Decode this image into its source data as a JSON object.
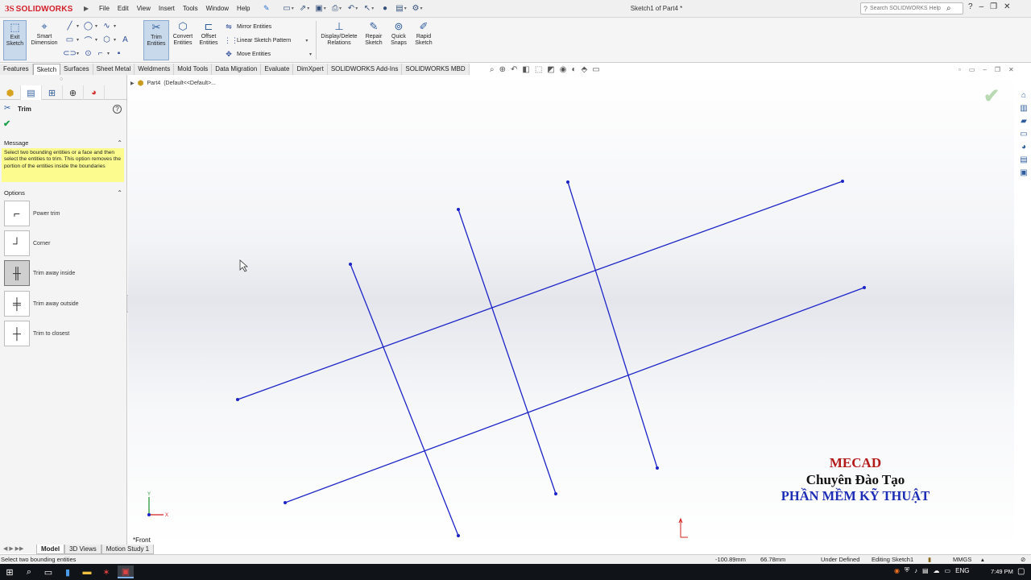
{
  "app": {
    "logo_ds": "3S",
    "logo_name": "SOLIDWORKS",
    "doc_title": "Sketch1 of Part4 *"
  },
  "menu": [
    "File",
    "Edit",
    "View",
    "Insert",
    "Tools",
    "Window",
    "Help"
  ],
  "search": {
    "placeholder": "Search SOLIDWORKS Help"
  },
  "command_manager": {
    "exit_sketch": "Exit\nSketch",
    "smart_dimension": "Smart\nDimension",
    "trim_entities": "Trim\nEntities",
    "convert_entities": "Convert\nEntities",
    "offset_entities": "Offset\nEntities",
    "mirror_entities": "Mirror Entities",
    "linear_sketch_pattern": "Linear Sketch Pattern",
    "move_entities": "Move Entities",
    "display_delete_relations": "Display/Delete\nRelations",
    "repair_sketch": "Repair\nSketch",
    "quick_snaps": "Quick\nSnaps",
    "rapid_sketch": "Rapid\nSketch"
  },
  "tabs": [
    "Features",
    "Sketch",
    "Surfaces",
    "Sheet Metal",
    "Weldments",
    "Mold Tools",
    "Data Migration",
    "Evaluate",
    "DimXpert",
    "SOLIDWORKS Add-Ins",
    "SOLIDWORKS MBD"
  ],
  "active_tab": "Sketch",
  "property_manager": {
    "title": "Trim",
    "message_header": "Message",
    "message": "Select two bounding entities or a face and then select the entities to trim. This option removes the portion of the entities inside the boundaries",
    "options_header": "Options",
    "options": [
      {
        "label": "Power trim",
        "selected": false
      },
      {
        "label": "Corner",
        "selected": false
      },
      {
        "label": "Trim away inside",
        "selected": true
      },
      {
        "label": "Trim away outside",
        "selected": false
      },
      {
        "label": "Trim to closest",
        "selected": false
      }
    ]
  },
  "tree": {
    "part": "Part4",
    "config": "(Default<<Default>..."
  },
  "view_label": "*Front",
  "watermark": {
    "line1": "MECAD",
    "line2": "Chuyên  Đào Tạo",
    "line3": "PHẦN MỀM KỸ THUẬT"
  },
  "bottom_tabs": [
    "Model",
    "3D Views",
    "Motion Study 1"
  ],
  "active_bottom_tab": "Model",
  "status": {
    "hint": "Select two bounding entities",
    "x": "-100.89mm",
    "y": "66.78mm",
    "state": "Under Defined",
    "mode": "Editing Sketch1",
    "units": "MMGS"
  },
  "taskbar": {
    "lang": "ENG",
    "time": "7:49 PM"
  },
  "colors": {
    "sketch_line": "#1c24c8",
    "brand_red": "#d4202b",
    "message_bg": "#fcfc8e"
  }
}
